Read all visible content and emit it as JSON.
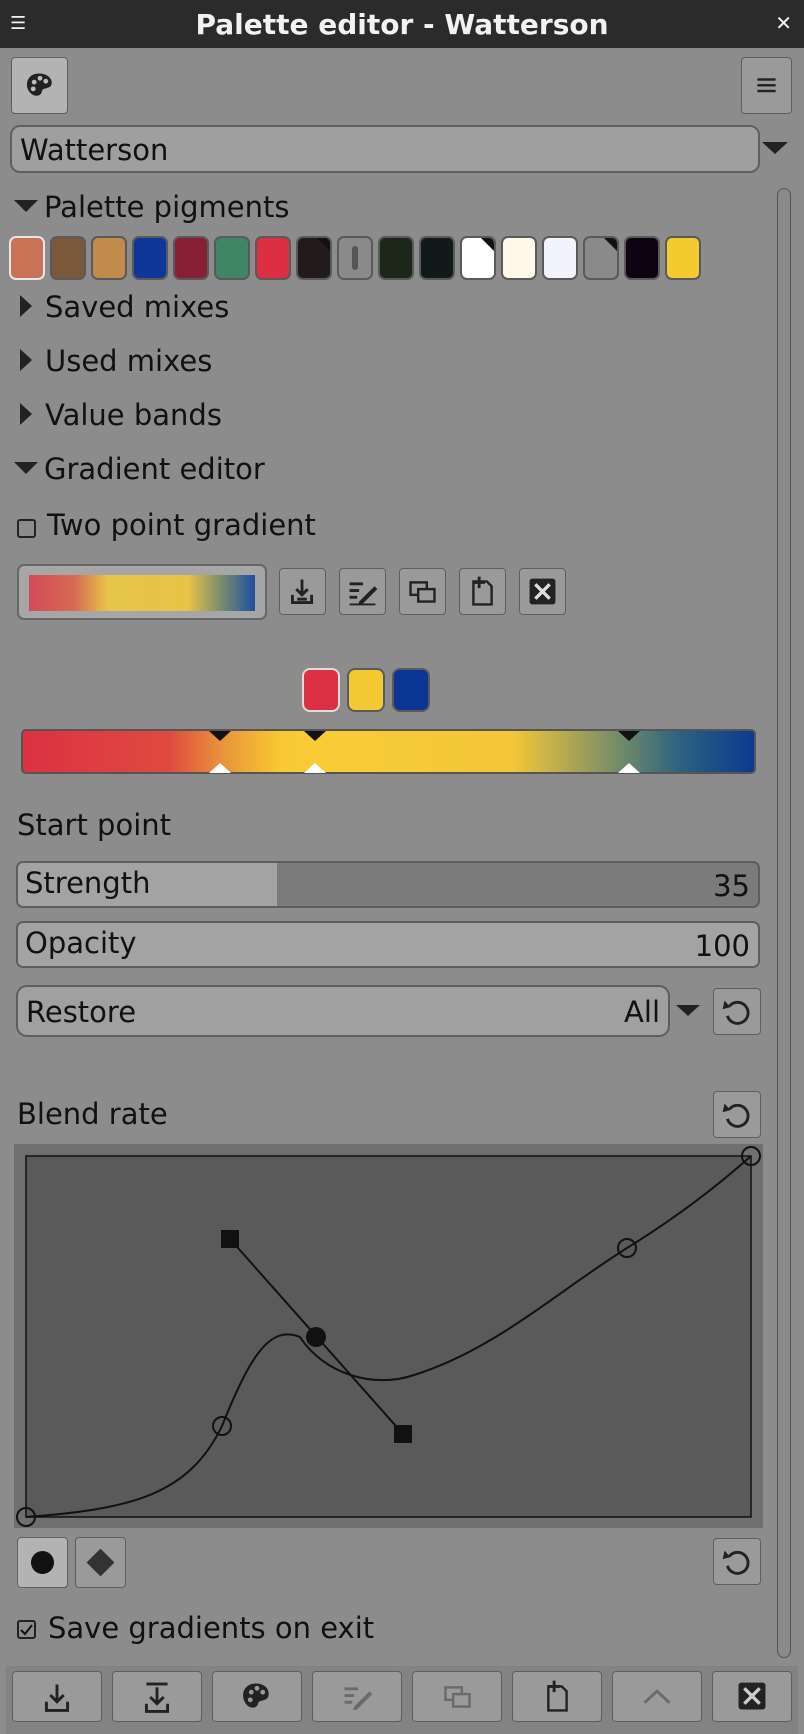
{
  "window": {
    "title": "Palette editor - Watterson"
  },
  "palette": {
    "selected": "Watterson"
  },
  "sections": {
    "pigments": "Palette pigments",
    "saved": "Saved mixes",
    "used": "Used mixes",
    "bands": "Value bands",
    "gradient": "Gradient editor"
  },
  "pigments": [
    "#c87356",
    "#7b583a",
    "#c28b4c",
    "#0f3799",
    "#891f34",
    "#3f8665",
    "#dd2f42",
    "#211b1b",
    "#8a8a8a",
    "#1c2619",
    "#11191b",
    "#ffffff",
    "#fff7ea",
    "#f2f4fd",
    "#8a8a8a",
    "#0d0312",
    "#f5ca2f"
  ],
  "gradient": {
    "two_point_label": "Two point gradient",
    "two_point_checked": false,
    "color_stops": [
      "#dc3142",
      "#f4c833",
      "#0a3594"
    ],
    "start_point_label": "Start point",
    "strength": {
      "label": "Strength",
      "value": "35",
      "fraction": 0.35
    },
    "opacity": {
      "label": "Opacity",
      "value": "100",
      "fraction": 1.0
    },
    "restore": {
      "label": "Restore",
      "value": "All"
    }
  },
  "blend": {
    "label": "Blend rate",
    "save_on_exit_label": "Save gradients on exit",
    "save_on_exit_checked": true
  }
}
